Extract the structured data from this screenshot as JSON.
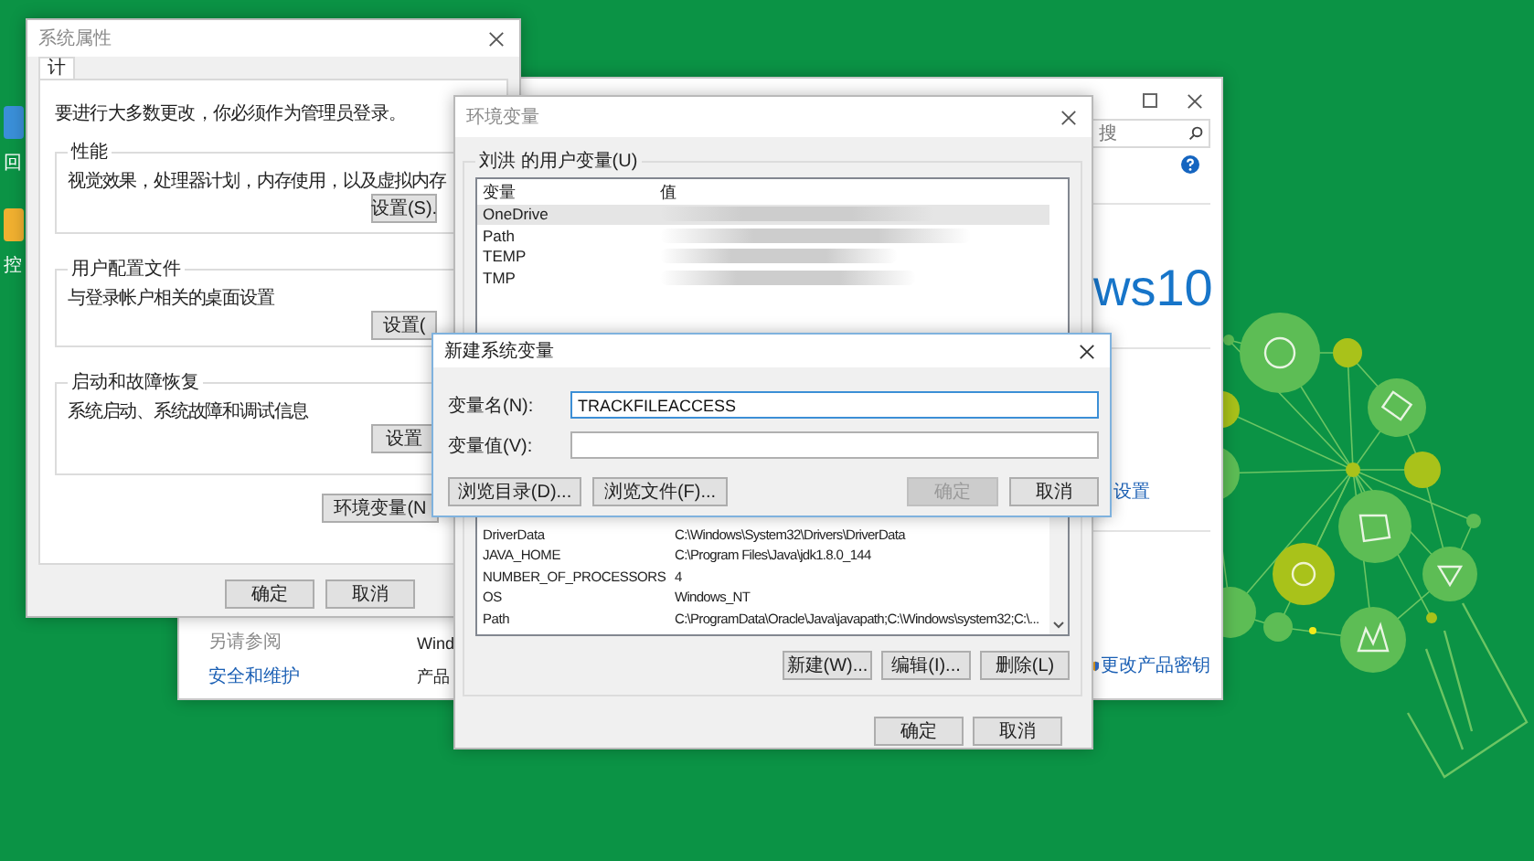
{
  "desktop": {
    "icons": [
      {
        "label": "回"
      },
      {
        "label": "控"
      }
    ]
  },
  "control_panel": {
    "search": {
      "placeholder": "搜"
    },
    "brand": "ws10",
    "settings_link": "设置",
    "product_key_link": "更改产品密钥",
    "see_also": {
      "title": "另请参阅",
      "links": [
        "安全和维护"
      ]
    },
    "fragments": [
      "Wind",
      "产品"
    ]
  },
  "system_properties": {
    "title": "系统属性",
    "tabs": [
      {
        "label": "计",
        "selected": true
      }
    ],
    "notice": "要进行大多数更改，你必须作为管理员登录。",
    "groups": [
      {
        "title": "性能",
        "description": "视觉效果，处理器计划，内存使用，以及虚拟内存",
        "button": "设置(S)."
      },
      {
        "title": "用户配置文件",
        "description": "与登录帐户相关的桌面设置",
        "button": "设置("
      },
      {
        "title": "启动和故障恢复",
        "description": "系统启动、系统故障和调试信息",
        "button": "设置"
      }
    ],
    "env_button": "环境变量(N",
    "buttons": [
      "确定",
      "取消"
    ]
  },
  "environment_variables": {
    "title": "环境变量",
    "user_group": "刘洪 的用户变量(U)",
    "columns": [
      "变量",
      "值"
    ],
    "user_rows": [
      {
        "name": "OneDrive",
        "selected": true
      },
      {
        "name": "Path",
        "selected": false
      },
      {
        "name": "TEMP",
        "selected": false
      },
      {
        "name": "TMP",
        "selected": false
      }
    ],
    "system_rows": [
      {
        "name": "DriverData",
        "value": "C:\\Windows\\System32\\Drivers\\DriverData"
      },
      {
        "name": "JAVA_HOME",
        "value": "C:\\Program Files\\Java\\jdk1.8.0_144"
      },
      {
        "name": "NUMBER_OF_PROCESSORS",
        "value": "4"
      },
      {
        "name": "OS",
        "value": "Windows_NT"
      },
      {
        "name": "Path",
        "value": "C:\\ProgramData\\Oracle\\Java\\javapath;C:\\Windows\\system32;C:\\..."
      }
    ],
    "list_buttons": [
      "新建(W)...",
      "编辑(I)...",
      "删除(L)"
    ],
    "buttons": [
      "确定",
      "取消"
    ]
  },
  "new_variable_dialog": {
    "title": "新建系统变量",
    "fields": [
      {
        "label": "变量名(N):",
        "value": "TRACKFILEACCESS",
        "focused": true
      },
      {
        "label": "变量值(V):",
        "focused": false
      }
    ],
    "buttons": [
      {
        "label": "浏览目录(D)...",
        "disabled": false
      },
      {
        "label": "浏览文件(F)...",
        "disabled": false
      },
      {
        "label": "确定",
        "disabled": true
      },
      {
        "label": "取消",
        "disabled": false
      }
    ]
  }
}
